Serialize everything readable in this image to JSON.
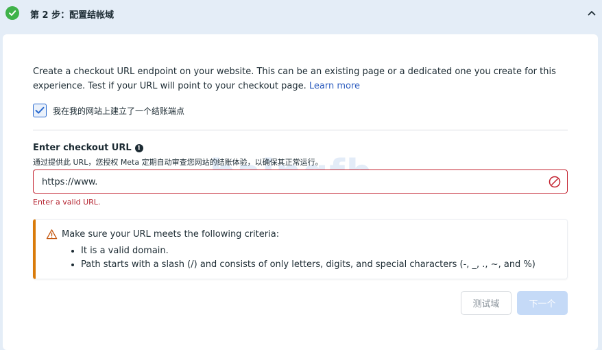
{
  "step": {
    "title": "第 2 步：配置结帐域",
    "status_color": "#3fb24a"
  },
  "intro": {
    "text": "Create a checkout URL endpoint on your website. This can be an existing page or a dedicated one you create for this experience. Test if your URL will point to your checkout page.",
    "link": "Learn more"
  },
  "confirm_checkbox": {
    "checked": true,
    "label": "我在我的网站上建立了一个结账端点"
  },
  "url_field": {
    "label": "Enter checkout URL",
    "help": "通过提供此 URL，您授权 Meta 定期自动审查您网站的结账体验，以确保其正常运行。",
    "value": "https://www.",
    "error": "Enter a valid URL."
  },
  "watermark": "baingfb",
  "criteria": {
    "title": "Make sure your URL meets the following criteria:",
    "items": [
      "It is a valid domain.",
      "Path starts with a slash (/) and consists of only letters, digits, and special characters (-, _, ., ~, and %)"
    ],
    "accent_color": "#d97b0a"
  },
  "buttons": {
    "test": "测试域",
    "next": "下一个"
  },
  "icons": {
    "step_status": "check-circle-icon",
    "collapse": "chevron-up-icon",
    "info": "info-icon",
    "error": "error-circle-icon",
    "warning": "warning-triangle-icon"
  }
}
